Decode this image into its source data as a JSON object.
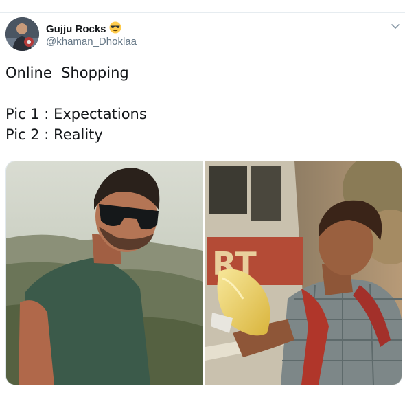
{
  "tweet": {
    "user": {
      "name": "Gujju Rocks",
      "emoji": "😎",
      "handle": "@khaman_Dhoklaa"
    },
    "text_lines": [
      "Online  Shopping",
      "Pic 1 : Expectations",
      "Pic 2 : Reality"
    ],
    "media": [
      {
        "label": "Pic 1",
        "subject": "man in sunglasses and green t-shirt with hills background"
      },
      {
        "label": "Pic 2",
        "subject": "man holding a plastic bag beside a bus"
      }
    ]
  },
  "colors": {
    "text": "#14171a",
    "secondary": "#657786",
    "border": "#e6ecf0"
  },
  "icons": [
    "avatar",
    "sunglasses-emoji",
    "chevron-down-icon"
  ]
}
